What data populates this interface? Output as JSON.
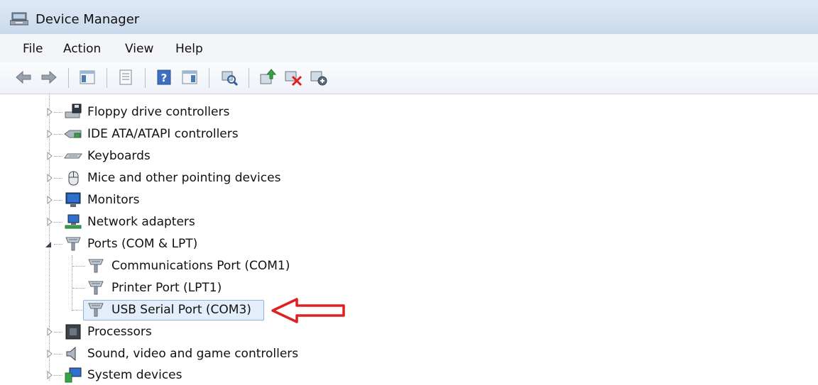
{
  "window": {
    "title": "Device Manager",
    "icon": "device-manager-icon"
  },
  "menu": [
    "File",
    "Action",
    "View",
    "Help"
  ],
  "toolbar": [
    "back-icon",
    "forward-icon",
    "show-hide-console-tree-icon",
    "properties-icon",
    "help-icon",
    "action-pane-icon",
    "scan-hardware-icon",
    "update-driver-icon",
    "uninstall-icon",
    "disable-icon"
  ],
  "tree": [
    {
      "label": "Floppy drive controllers",
      "icon": "floppy-drive-icon",
      "expanded": false
    },
    {
      "label": "IDE ATA/ATAPI controllers",
      "icon": "ide-controller-icon",
      "expanded": false
    },
    {
      "label": "Keyboards",
      "icon": "keyboard-icon",
      "expanded": false
    },
    {
      "label": "Mice and other pointing devices",
      "icon": "mouse-icon",
      "expanded": false
    },
    {
      "label": "Monitors",
      "icon": "monitor-icon",
      "expanded": false
    },
    {
      "label": "Network adapters",
      "icon": "network-adapter-icon",
      "expanded": false
    },
    {
      "label": "Ports (COM & LPT)",
      "icon": "port-icon",
      "expanded": true,
      "children": [
        {
          "label": "Communications Port (COM1)",
          "icon": "port-icon"
        },
        {
          "label": "Printer Port (LPT1)",
          "icon": "port-icon"
        },
        {
          "label": "USB Serial Port (COM3)",
          "icon": "port-icon",
          "selected": true
        }
      ]
    },
    {
      "label": "Processors",
      "icon": "processor-icon",
      "expanded": false
    },
    {
      "label": "Sound, video and game controllers",
      "icon": "speaker-icon",
      "expanded": false
    },
    {
      "label": "System devices",
      "icon": "system-devices-icon",
      "expanded": false
    }
  ],
  "annotation": {
    "color": "#e02020",
    "icon": "red-arrow-icon"
  }
}
